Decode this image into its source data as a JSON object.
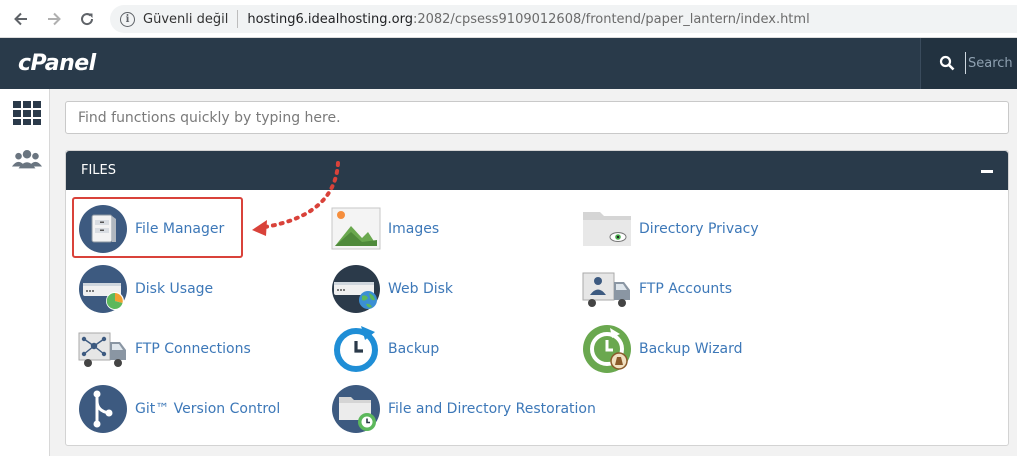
{
  "browser": {
    "security_label": "Güvenli değil",
    "url_host": "hosting6.idealhosting.org",
    "url_rest": ":2082/cpsess9109012608/frontend/paper_lantern/index.html"
  },
  "header": {
    "logo": "cPanel",
    "search_placeholder": "Search ( /"
  },
  "main": {
    "quick_search_placeholder": "Find functions quickly by typing here."
  },
  "files_panel": {
    "title": "FILES",
    "items": [
      {
        "label": "File Manager",
        "icon": "file-manager-icon"
      },
      {
        "label": "Images",
        "icon": "images-icon"
      },
      {
        "label": "Directory Privacy",
        "icon": "directory-privacy-icon"
      },
      {
        "label": "Disk Usage",
        "icon": "disk-usage-icon"
      },
      {
        "label": "Web Disk",
        "icon": "web-disk-icon"
      },
      {
        "label": "FTP Accounts",
        "icon": "ftp-accounts-icon"
      },
      {
        "label": "FTP Connections",
        "icon": "ftp-connections-icon"
      },
      {
        "label": "Backup",
        "icon": "backup-icon"
      },
      {
        "label": "Backup Wizard",
        "icon": "backup-wizard-icon"
      },
      {
        "label": "Git™ Version Control",
        "icon": "git-icon"
      },
      {
        "label": "File and Directory Restoration",
        "icon": "file-restoration-icon"
      }
    ]
  },
  "colors": {
    "header_bg": "#293a4a",
    "link": "#3d78b8",
    "highlight": "#d9423a"
  }
}
